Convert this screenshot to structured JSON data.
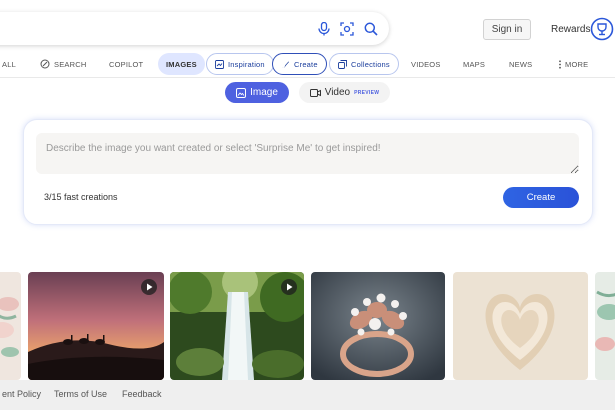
{
  "header": {
    "sign_in": "Sign in",
    "rewards": "Rewards",
    "icons": [
      "microphone-icon",
      "visual-search-icon",
      "search-icon",
      "rewards-trophy-icon"
    ]
  },
  "nav": {
    "all": "ALL",
    "search": "SEARCH",
    "copilot": "COPILOT",
    "images": "IMAGES",
    "inspiration": "Inspiration",
    "create": "Create",
    "collections": "Collections",
    "videos": "VIDEOS",
    "maps": "MAPS",
    "news": "NEWS",
    "more": "MORE"
  },
  "mode": {
    "image": "Image",
    "video": "Video",
    "preview": "PREVIEW"
  },
  "prompt": {
    "placeholder": "Describe the image you want created or select 'Surprise Me' to get inspired!",
    "value": "",
    "counter": "3/15 fast creations",
    "create_label": "Create"
  },
  "gallery": {
    "items": [
      "floral-paper-art",
      "desert-camel-caravan",
      "forest-waterfall",
      "pearl-flower-ring",
      "paper-heart",
      "floral-paper-art-2"
    ],
    "video_items": [
      "desert-camel-caravan",
      "forest-waterfall"
    ]
  },
  "footer": {
    "privacy": "ent Policy",
    "terms": "Terms of Use",
    "feedback": "Feedback"
  },
  "colors": {
    "accent": "#4e61e0",
    "create_button": "#2f64e3",
    "images_pill": "#dfe6ff"
  }
}
